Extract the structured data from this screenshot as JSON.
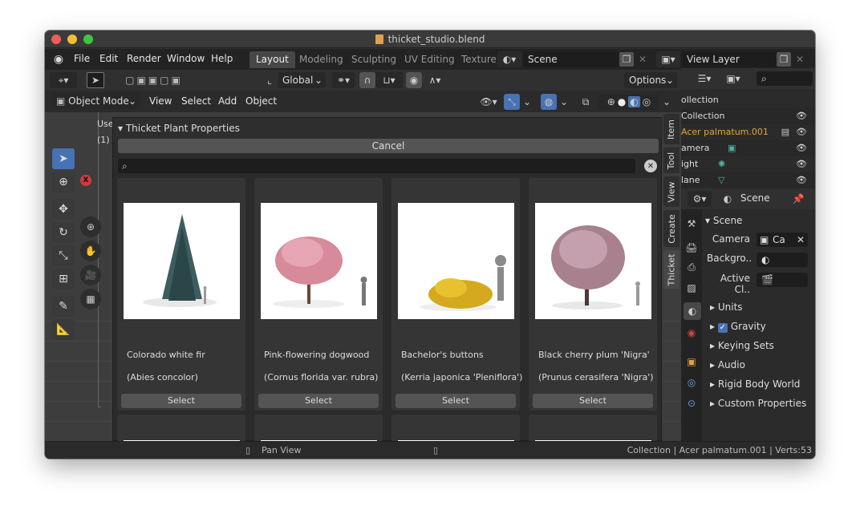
{
  "window": {
    "title": "thicket_studio.blend"
  },
  "menu": [
    "File",
    "Edit",
    "Render",
    "Window",
    "Help"
  ],
  "workspaces": [
    "Layout",
    "Modeling",
    "Sculpting",
    "UV Editing",
    "Texture"
  ],
  "scene_selector": {
    "value": "Scene"
  },
  "view_layer_selector": {
    "value": "View Layer"
  },
  "toolbar": {
    "orientation": "Global",
    "options": "Options"
  },
  "header": {
    "mode": "Object Mode",
    "menus": [
      "View",
      "Select",
      "Add",
      "Object"
    ]
  },
  "viewport_overlay": {
    "label": "Use",
    "count": "(1)"
  },
  "sidebar_tabs": [
    "Item",
    "Tool",
    "View",
    "Create",
    "Thicket"
  ],
  "panel": {
    "title": "Thicket Plant Properties",
    "cancel_label": "Cancel",
    "search_placeholder": "",
    "select_label": "Select",
    "plants": [
      {
        "name": "Colorado white fir",
        "scientific": "(Abies concolor)"
      },
      {
        "name": "Pink-flowering dogwood",
        "scientific": "(Cornus florida var. rubra)"
      },
      {
        "name": "Bachelor's buttons",
        "scientific": "(Kerria japonica 'Pleniflora')"
      },
      {
        "name": "Black cherry plum 'Nigra'",
        "scientific": "(Prunus cerasifera 'Nigra')"
      }
    ]
  },
  "outliner": {
    "rows": [
      "ollection",
      "Collection",
      "Acer palmatum.001",
      "amera",
      "ight",
      "lane"
    ]
  },
  "properties": {
    "scene_label": "Scene",
    "section": "Scene",
    "camera_label": "Camera",
    "camera_value": "Ca",
    "background_label": "Backgro..",
    "active_clip_label": "Active Cl..",
    "subsections": [
      "Units",
      "Gravity",
      "Keying Sets",
      "Audio",
      "Rigid Body World",
      "Custom Properties"
    ]
  },
  "status": {
    "hint": "Pan View",
    "info": "Collection | Acer palmatum.001 | Verts:53"
  },
  "colors": {
    "accent": "#4772b3",
    "active_object": "#e8a23c",
    "camera_icon": "#4fb5a3"
  }
}
